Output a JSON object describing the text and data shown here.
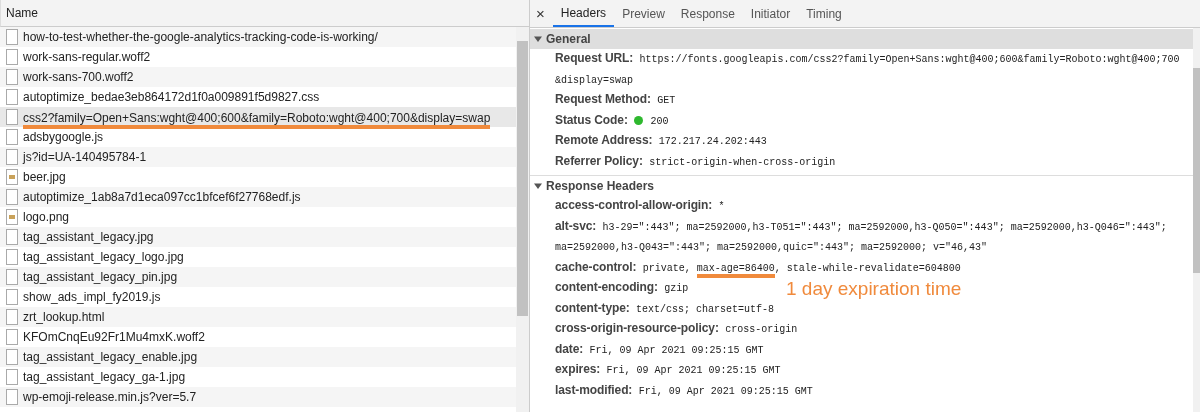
{
  "network_list": {
    "column_header": "Name",
    "files": [
      {
        "name": "how-to-test-whether-the-google-analytics-tracking-code-is-working/",
        "kind": "document",
        "selected": false,
        "underlined": false
      },
      {
        "name": "work-sans-regular.woff2",
        "kind": "document",
        "selected": false,
        "underlined": false
      },
      {
        "name": "work-sans-700.woff2",
        "kind": "document",
        "selected": false,
        "underlined": false
      },
      {
        "name": "autoptimize_bedae3eb864172d1f0a009891f5d9827.css",
        "kind": "document",
        "selected": false,
        "underlined": false
      },
      {
        "name": "css2?family=Open+Sans:wght@400;600&family=Roboto:wght@400;700&display=swap",
        "kind": "document",
        "selected": true,
        "underlined": true
      },
      {
        "name": "adsbygoogle.js",
        "kind": "document",
        "selected": false,
        "underlined": false
      },
      {
        "name": "js?id=UA-140495784-1",
        "kind": "document",
        "selected": false,
        "underlined": false
      },
      {
        "name": "beer.jpg",
        "kind": "image",
        "selected": false,
        "underlined": false
      },
      {
        "name": "autoptimize_1ab8a7d1eca097cc1bfcef6f27768edf.js",
        "kind": "document",
        "selected": false,
        "underlined": false
      },
      {
        "name": "logo.png",
        "kind": "image",
        "selected": false,
        "underlined": false
      },
      {
        "name": "tag_assistant_legacy.jpg",
        "kind": "document",
        "selected": false,
        "underlined": false
      },
      {
        "name": "tag_assistant_legacy_logo.jpg",
        "kind": "document",
        "selected": false,
        "underlined": false
      },
      {
        "name": "tag_assistant_legacy_pin.jpg",
        "kind": "document",
        "selected": false,
        "underlined": false
      },
      {
        "name": "show_ads_impl_fy2019.js",
        "kind": "document",
        "selected": false,
        "underlined": false
      },
      {
        "name": "zrt_lookup.html",
        "kind": "document",
        "selected": false,
        "underlined": false
      },
      {
        "name": "KFOmCnqEu92Fr1Mu4mxK.woff2",
        "kind": "document",
        "selected": false,
        "underlined": false
      },
      {
        "name": "tag_assistant_legacy_enable.jpg",
        "kind": "document",
        "selected": false,
        "underlined": false
      },
      {
        "name": "tag_assistant_legacy_ga-1.jpg",
        "kind": "document",
        "selected": false,
        "underlined": false
      },
      {
        "name": "wp-emoji-release.min.js?ver=5.7",
        "kind": "document",
        "selected": false,
        "underlined": false
      }
    ]
  },
  "details": {
    "close": "×",
    "tabs": [
      {
        "label": "Headers",
        "selected": true
      },
      {
        "label": "Preview",
        "selected": false
      },
      {
        "label": "Response",
        "selected": false
      },
      {
        "label": "Initiator",
        "selected": false
      },
      {
        "label": "Timing",
        "selected": false
      }
    ],
    "sections": [
      {
        "title": "General",
        "expanded": true,
        "rows": [
          {
            "key": "Request URL:",
            "parts": [
              {
                "text": "https://fonts.googleapis.com/css2?family=Open+Sans:wght@400;600&family=Roboto:wght@400;700",
                "underlined": false
              },
              {
                "text": "&display=swap",
                "underlined": false,
                "new_line": true
              }
            ]
          },
          {
            "key": "Request Method:",
            "parts": [
              {
                "text": "GET",
                "underlined": false
              }
            ]
          },
          {
            "key": "Status Code:",
            "color": "#2eb82e",
            "parts": [
              {
                "text": "200",
                "underlined": false
              }
            ]
          },
          {
            "key": "Remote Address:",
            "parts": [
              {
                "text": "172.217.24.202:443",
                "underlined": false
              }
            ]
          },
          {
            "key": "Referrer Policy:",
            "parts": [
              {
                "text": "strict-origin-when-cross-origin",
                "underlined": false
              }
            ]
          }
        ]
      },
      {
        "title": "Response Headers",
        "expanded": true,
        "rows": [
          {
            "key": "access-control-allow-origin:",
            "parts": [
              {
                "text": "*",
                "underlined": false
              }
            ]
          },
          {
            "key": "alt-svc:",
            "parts": [
              {
                "text": "h3-29=\":443\"; ma=2592000,h3-T051=\":443\"; ma=2592000,h3-Q050=\":443\"; ma=2592000,h3-Q046=\":443\";",
                "underlined": false
              },
              {
                "text": "ma=2592000,h3-Q043=\":443\"; ma=2592000,quic=\":443\"; ma=2592000; v=\"46,43\"",
                "underlined": false,
                "new_line": true
              }
            ]
          },
          {
            "key": "cache-control:",
            "parts": [
              {
                "text": "private, ",
                "underlined": false
              },
              {
                "text": "max-age=86400",
                "underlined": true,
                "note": "1 day expiration time"
              },
              {
                "text": ", stale-while-revalidate=604800",
                "underlined": false
              }
            ]
          },
          {
            "key": "content-encoding:",
            "parts": [
              {
                "text": "gzip",
                "underlined": false
              }
            ]
          },
          {
            "key": "content-type:",
            "parts": [
              {
                "text": "text/css; charset=utf-8",
                "underlined": false
              }
            ]
          },
          {
            "key": "cross-origin-resource-policy:",
            "parts": [
              {
                "text": "cross-origin",
                "underlined": false
              }
            ]
          },
          {
            "key": "date:",
            "parts": [
              {
                "text": "Fri, 09 Apr 2021 09:25:15 GMT",
                "underlined": false
              }
            ]
          },
          {
            "key": "expires:",
            "parts": [
              {
                "text": "Fri, 09 Apr 2021 09:25:15 GMT",
                "underlined": false
              }
            ]
          },
          {
            "key": "last-modified:",
            "parts": [
              {
                "text": "Fri, 09 Apr 2021 09:25:15 GMT",
                "underlined": false
              }
            ]
          }
        ]
      }
    ]
  }
}
